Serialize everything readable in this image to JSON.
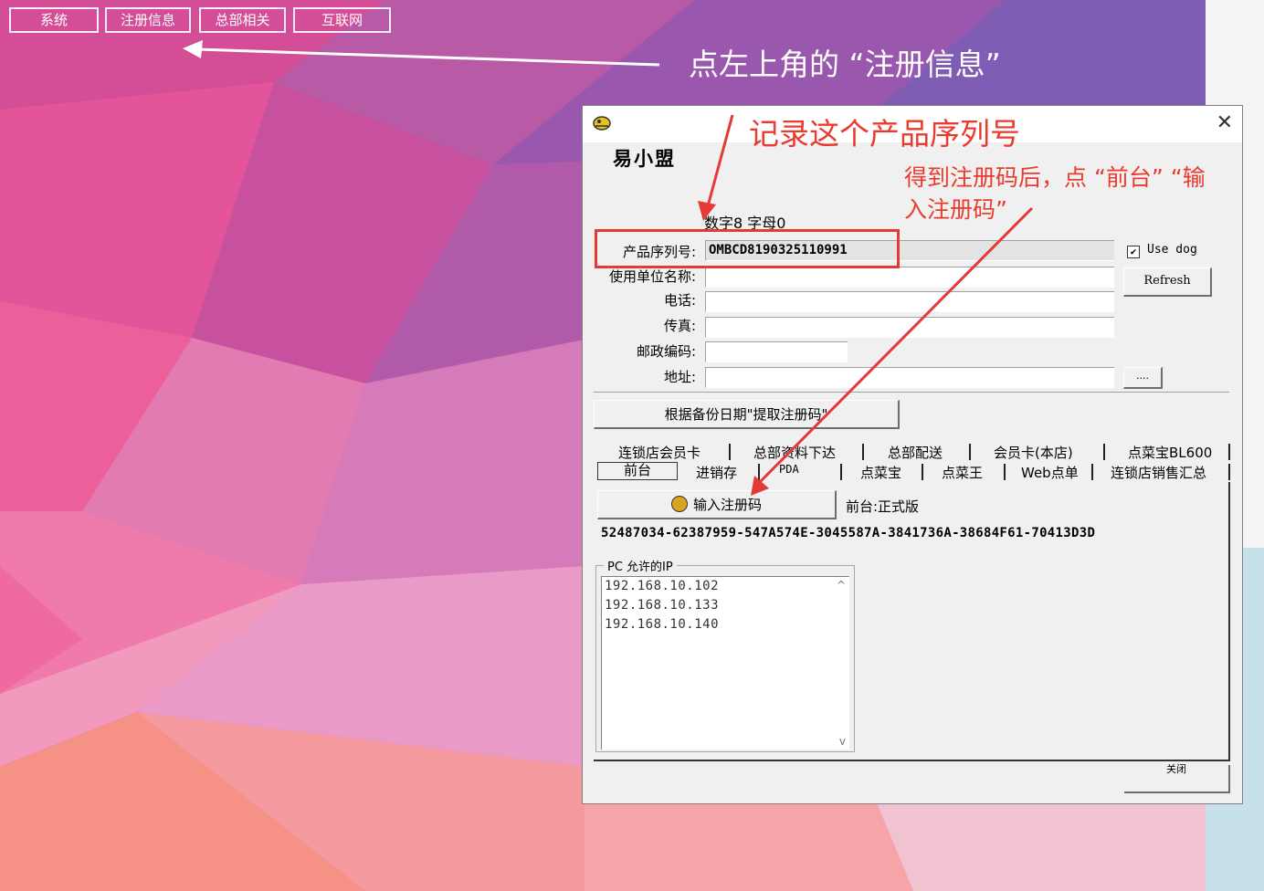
{
  "colors": {
    "annotation_red": "#e53935",
    "dialog_bg": "#f0f0f0",
    "caption_white": "#ffffff"
  },
  "menu": {
    "items": [
      "系统",
      "注册信息",
      "总部相关",
      "互联网"
    ]
  },
  "caption": "点左上角的 “注册信息”",
  "annotations": {
    "serial_note": "记录这个产品序列号",
    "reg_note_line1": "得到注册码后，点 “前台”   “输",
    "reg_note_line2": "入注册码”"
  },
  "dialog": {
    "icon": "app-icon",
    "close_icon": "close-icon",
    "app_name": "易小盟",
    "counter": "数字8 字母0",
    "fields": {
      "serial_label": "产品序列号:",
      "serial_value": "OMBCD8190325110991",
      "company_label": "使用单位名称:",
      "company_value": "",
      "phone_label": "电话:",
      "phone_value": "",
      "fax_label": "传真:",
      "fax_value": "",
      "postcode_label": "邮政编码:",
      "postcode_value": "",
      "address_label": "地址:",
      "address_value": ""
    },
    "use_dog_label": "Use dog",
    "use_dog_checked": true,
    "refresh_label": "Refresh",
    "browse_label": "....",
    "fetch_button": "根据备份日期\"提取注册码\"",
    "tabs_row1": [
      "连锁店会员卡",
      "总部资料下达",
      "总部配送",
      "会员卡(本店)",
      "点菜宝BL600"
    ],
    "tabs_row2": [
      "前台",
      "进销存",
      "PDA",
      "点菜宝",
      "点菜王",
      "Web点单",
      "连锁店销售汇总"
    ],
    "enter_code_button": "输入注册码",
    "front_version": "前台:正式版",
    "reg_code": "52487034-62387959-547A574E-3045587A-3841736A-38684F61-70413D3D",
    "ip_group_title": "PC 允许的IP",
    "ips": [
      "192.168.10.102",
      "192.168.10.133",
      "192.168.10.140"
    ],
    "bottom_button": "关闭"
  }
}
